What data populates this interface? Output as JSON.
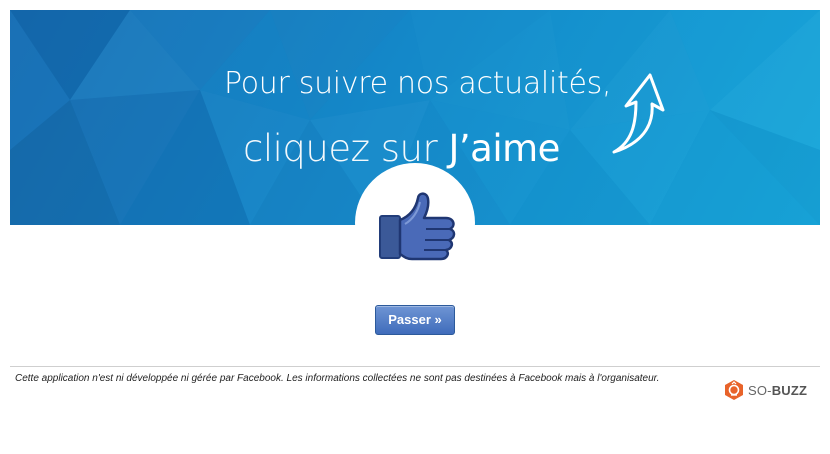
{
  "banner": {
    "headline_line1": "Pour suivre nos actualités,",
    "headline_line2_part1": "cliquez sur ",
    "headline_line2_part2": "J’aime"
  },
  "actions": {
    "skip_label": "Passer »"
  },
  "footer": {
    "disclaimer": "Cette application n'est ni développée ni gérée par Facebook. Les informations collectées ne sont pas destinées à Facebook mais à l'organisateur.",
    "brand_prefix": "SO-",
    "brand_suffix": "BUZZ"
  },
  "colors": {
    "banner_dark": "#1a6fb3",
    "banner_light": "#19a6d8",
    "facebook_blue": "#3b5998",
    "button_blue": "#4a76c0",
    "brand_orange": "#e8632a"
  },
  "icons": {
    "arrow": "curved-up-arrow-icon",
    "like": "thumbs-up-icon",
    "brand": "so-buzz-logo-icon"
  }
}
